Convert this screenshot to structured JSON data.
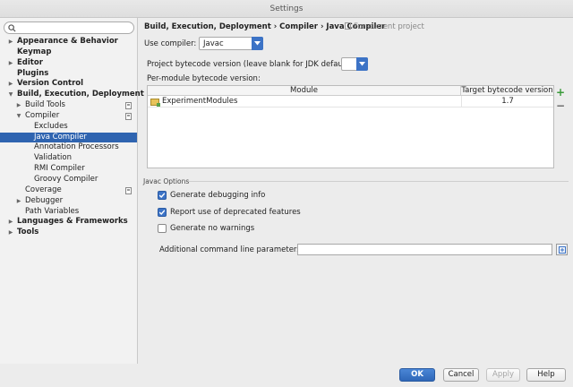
{
  "window": {
    "title": "Settings"
  },
  "sidebar": {
    "search_placeholder": "",
    "items": [
      {
        "label": "Appearance & Behavior",
        "bold": true,
        "arrow": "▶",
        "level": 0
      },
      {
        "label": "Keymap",
        "bold": true,
        "arrow": "",
        "level": 0
      },
      {
        "label": "Editor",
        "bold": true,
        "arrow": "▶",
        "level": 0
      },
      {
        "label": "Plugins",
        "bold": true,
        "arrow": "",
        "level": 0
      },
      {
        "label": "Version Control",
        "bold": true,
        "arrow": "▶",
        "level": 0
      },
      {
        "label": "Build, Execution, Deployment",
        "bold": true,
        "arrow": "▼",
        "level": 0
      },
      {
        "label": "Build Tools",
        "bold": false,
        "arrow": "▶",
        "level": 1,
        "project": true
      },
      {
        "label": "Compiler",
        "bold": false,
        "arrow": "▼",
        "level": 1,
        "project": true
      },
      {
        "label": "Excludes",
        "bold": false,
        "arrow": "",
        "level": 2
      },
      {
        "label": "Java Compiler",
        "bold": false,
        "arrow": "",
        "level": 2,
        "selected": true
      },
      {
        "label": "Annotation Processors",
        "bold": false,
        "arrow": "",
        "level": 2
      },
      {
        "label": "Validation",
        "bold": false,
        "arrow": "",
        "level": 2
      },
      {
        "label": "RMI Compiler",
        "bold": false,
        "arrow": "",
        "level": 2
      },
      {
        "label": "Groovy Compiler",
        "bold": false,
        "arrow": "",
        "level": 2
      },
      {
        "label": "Coverage",
        "bold": false,
        "arrow": "",
        "level": 1,
        "project": true
      },
      {
        "label": "Debugger",
        "bold": false,
        "arrow": "▶",
        "level": 1
      },
      {
        "label": "Path Variables",
        "bold": false,
        "arrow": "",
        "level": 1
      },
      {
        "label": "Languages & Frameworks",
        "bold": true,
        "arrow": "▶",
        "level": 0
      },
      {
        "label": "Tools",
        "bold": true,
        "arrow": "▶",
        "level": 0
      }
    ]
  },
  "main": {
    "breadcrumb": "Build, Execution, Deployment › Compiler › Java Compiler",
    "scope_note": "For current project",
    "use_compiler_label": "Use compiler:",
    "use_compiler_value": "Javac",
    "bytecode_label": "Project bytecode version (leave blank for JDK default):",
    "bytecode_value": "",
    "per_module_label": "Per-module bytecode version:",
    "table": {
      "headers": [
        "Module",
        "Target bytecode version"
      ],
      "rows": [
        {
          "module": "ExperimentModules",
          "version": "1.7"
        }
      ]
    },
    "add_symbol": "+",
    "remove_symbol": "−",
    "javac_group": "Javac Options",
    "options": [
      {
        "label": "Generate debugging info",
        "checked": true
      },
      {
        "label": "Report use of deprecated features",
        "checked": true
      },
      {
        "label": "Generate no warnings",
        "checked": false
      }
    ],
    "cmd_label": "Additional command line parameters:",
    "cmd_value": ""
  },
  "footer": {
    "ok": "OK",
    "cancel": "Cancel",
    "apply": "Apply",
    "help": "Help"
  },
  "colors": {
    "accent": "#3c73c6",
    "selection": "#2f64b0",
    "add": "#3a9a3a"
  }
}
